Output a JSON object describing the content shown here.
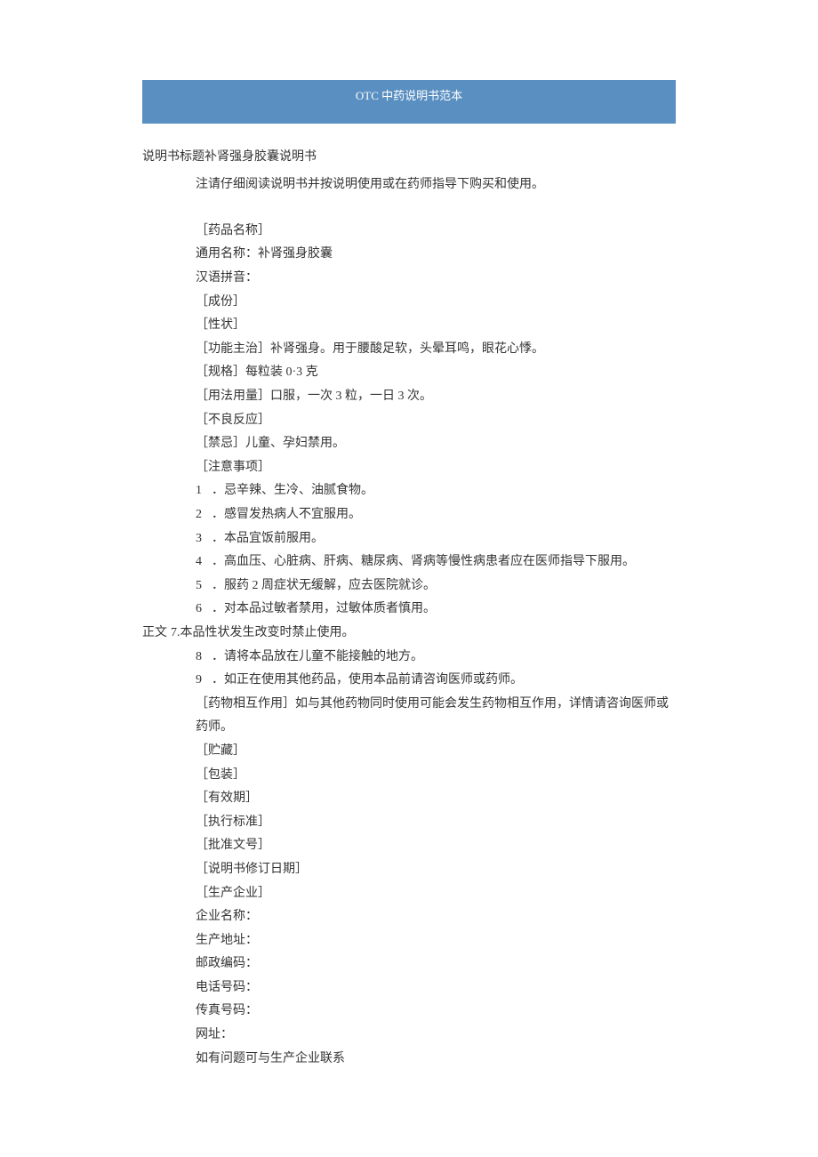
{
  "banner": "OTC 中药说明书范本",
  "titleLabel": "说明书标题",
  "titleValue": "补肾强身胶囊说明书",
  "noteLine": "注请仔细阅读说明书并按说明使用或在药师指导下购买和使用。",
  "lines": [
    {
      "type": "bracket",
      "label": "［药品名称］",
      "value": ""
    },
    {
      "type": "plain",
      "text": "通用名称：补肾强身胶囊"
    },
    {
      "type": "plain",
      "text": "汉语拼音："
    },
    {
      "type": "bracket",
      "label": "［成份］",
      "value": ""
    },
    {
      "type": "bracket",
      "label": "［性状］",
      "value": ""
    },
    {
      "type": "bracket",
      "label": "［功能主治］",
      "value": "补肾强身。用于腰酸足软，头晕耳鸣，眼花心悸。"
    },
    {
      "type": "bracket",
      "label": "［规格］",
      "value": "每粒装 0·3 克"
    },
    {
      "type": "bracket",
      "label": "［用法用量］",
      "value": "口服，一次 3 粒，一日 3 次。"
    },
    {
      "type": "bracket",
      "label": "［不良反应］",
      "value": ""
    },
    {
      "type": "bracket",
      "label": "［禁忌］",
      "value": "儿童、孕妇禁用。"
    },
    {
      "type": "bracket",
      "label": "［注意事项］",
      "value": ""
    },
    {
      "type": "numbered",
      "num": "1",
      "text": "．忌辛辣、生冷、油腻食物。"
    },
    {
      "type": "numbered",
      "num": "2",
      "text": "．感冒发热病人不宜服用。"
    },
    {
      "type": "numbered",
      "num": "3",
      "text": "．本品宜饭前服用。"
    },
    {
      "type": "numbered",
      "num": "4",
      "text": "．高血压、心脏病、肝病、糖尿病、肾病等慢性病患者应在医师指导下服用。"
    },
    {
      "type": "numbered",
      "num": "5",
      "text": "．服药 2 周症状无缓解，应去医院就诊。"
    },
    {
      "type": "numbered",
      "num": "6",
      "text": "．对本品过敏者禁用，过敏体质者慎用。"
    }
  ],
  "bodyPrefix": "正文",
  "body7": "7.本品性状发生改变时禁止使用。",
  "lines2": [
    {
      "type": "numbered",
      "num": "8",
      "text": "．请将本品放在儿童不能接触的地方。"
    },
    {
      "type": "numbered",
      "num": "9",
      "text": "．如正在使用其他药品，使用本品前请咨询医师或药师。"
    },
    {
      "type": "bracket",
      "label": "［药物相互作用］",
      "value": "如与其他药物同时使用可能会发生药物相互作用，详情请咨询医师或药师。"
    },
    {
      "type": "bracket",
      "label": "［贮藏］",
      "value": ""
    },
    {
      "type": "bracket",
      "label": "［包装］",
      "value": ""
    },
    {
      "type": "bracket",
      "label": "［有效期］",
      "value": ""
    },
    {
      "type": "bracket",
      "label": "［执行标准］",
      "value": ""
    },
    {
      "type": "bracket",
      "label": "［批准文号］",
      "value": ""
    },
    {
      "type": "bracket",
      "label": "［说明书修订日期］",
      "value": ""
    },
    {
      "type": "bracket",
      "label": "［生产企业］",
      "value": ""
    },
    {
      "type": "plain",
      "text": "企业名称："
    },
    {
      "type": "plain",
      "text": "生产地址："
    },
    {
      "type": "plain",
      "text": "邮政编码："
    },
    {
      "type": "plain",
      "text": "电话号码："
    },
    {
      "type": "plain",
      "text": "传真号码："
    },
    {
      "type": "plain",
      "text": "网址："
    },
    {
      "type": "plain",
      "text": "如有问题可与生产企业联系"
    }
  ]
}
